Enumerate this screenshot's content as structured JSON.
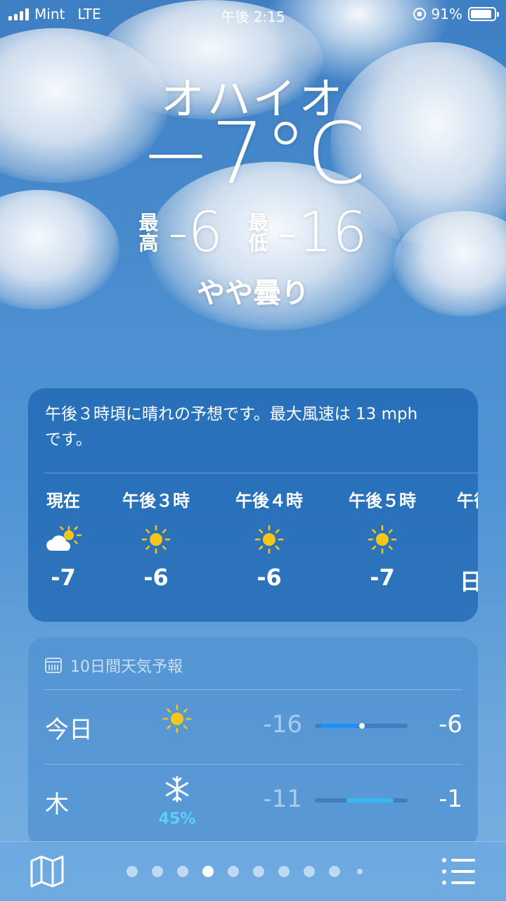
{
  "status_bar": {
    "carrier": "Mint",
    "network": "LTE",
    "time": "午後 2:15",
    "battery": "91%",
    "battery_level": 0.91
  },
  "location": {
    "city": "オハイオ",
    "temperature": "−7°C",
    "high_label": [
      "最",
      "高"
    ],
    "high": "-6",
    "low_label": [
      "最",
      "低"
    ],
    "low": "-16",
    "condition": "やや曇り"
  },
  "hourly": {
    "summary": "午後３時頃に晴れの予想です。最大風速は 13 mph です。",
    "items": [
      {
        "time": "現在",
        "icon": "partly-cloudy-icon",
        "temp": "-7"
      },
      {
        "time": "午後３時",
        "icon": "sun-icon",
        "temp": "-6"
      },
      {
        "time": "午後４時",
        "icon": "sun-icon",
        "temp": "-6"
      },
      {
        "time": "午後５時",
        "icon": "sun-icon",
        "temp": "-7"
      },
      {
        "time": "午後",
        "icon": "",
        "temp": "日"
      }
    ]
  },
  "daily": {
    "title": "10日間天気予報",
    "days": [
      {
        "day": "今日",
        "icon": "sun-icon",
        "precip": "",
        "low": "-16",
        "high": "-6",
        "range_start": 0.07,
        "range_end": 0.46,
        "current": 0.51,
        "range_color": "#1e90ff"
      },
      {
        "day": "木",
        "icon": "snowflake-icon",
        "precip": "45%",
        "low": "-11",
        "high": "-1",
        "range_start": 0.34,
        "range_end": 0.85,
        "current": null,
        "range_color": "#3ab8f0"
      }
    ]
  },
  "bottom": {
    "page_count": 10,
    "active_page": 3
  }
}
